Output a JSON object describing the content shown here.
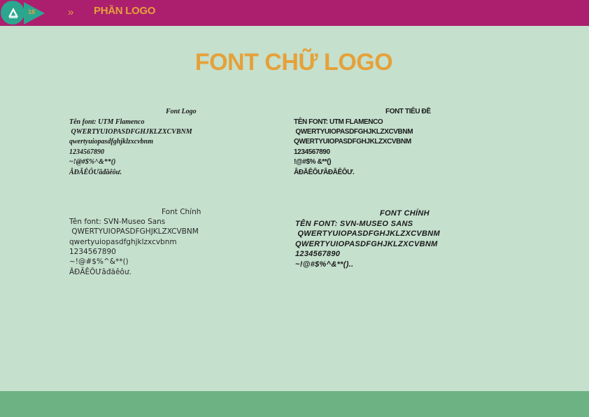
{
  "header": {
    "page_number": "18",
    "separator": "»",
    "section_title": "PHẦN LOGO"
  },
  "main": {
    "title": "FONT CHỮ LOGO"
  },
  "blocks": [
    {
      "heading": "Font Logo",
      "lines": [
        "Tên font: UTM Flamenco",
        " QWERTYUIOPASDFGHJKLZXCVBNM",
        "qwertyuiopasdfghjklzxcvbnm",
        "1234567890",
        "~!@#$%^&**()",
        "ÂĐĂÊÔƯâđăêôư."
      ]
    },
    {
      "heading": "FONT TIÊU ĐỀ",
      "lines": [
        "TÊN FONT: UTM FLAMENCO",
        " QWERTYUIOPASDFGHJKLZXCVBNM",
        "QWERTYUIOPASDFGHJKLZXCVBNM",
        "1234567890",
        "!@#$% &**()",
        "ÂĐĂÊÔƯÂĐĂÊÔƯ."
      ]
    },
    {
      "heading": "Font Chính",
      "lines": [
        "Tên font: SVN-Museo Sans",
        " QWERTYUIOPASDFGHJKLZXCVBNM",
        "qwertyuiopasdfghjklzxcvbnm",
        "1234567890",
        "~!@#$%^&**()",
        "ÂĐĂÊÔƯâđăêôư."
      ]
    },
    {
      "heading": "FONT CHÍNH",
      "lines": [
        "TÊN FONT: SVN-MUSEO SANS",
        " QWERTYUIOPASDFGHJKLZXCVBNM",
        "QWERTYUIOPASDFGHJKLZXCVBNM",
        "1234567890",
        "~!@#$%^&**().."
      ]
    }
  ],
  "colors": {
    "header_bar": "#ac1f6e",
    "accent": "#e5a13a",
    "badge": "#2aa78e",
    "background": "#c5e0cd",
    "footer_bar": "#6db283"
  },
  "icons": [
    "brand-logo-icon",
    "arrow-badge-icon"
  ]
}
